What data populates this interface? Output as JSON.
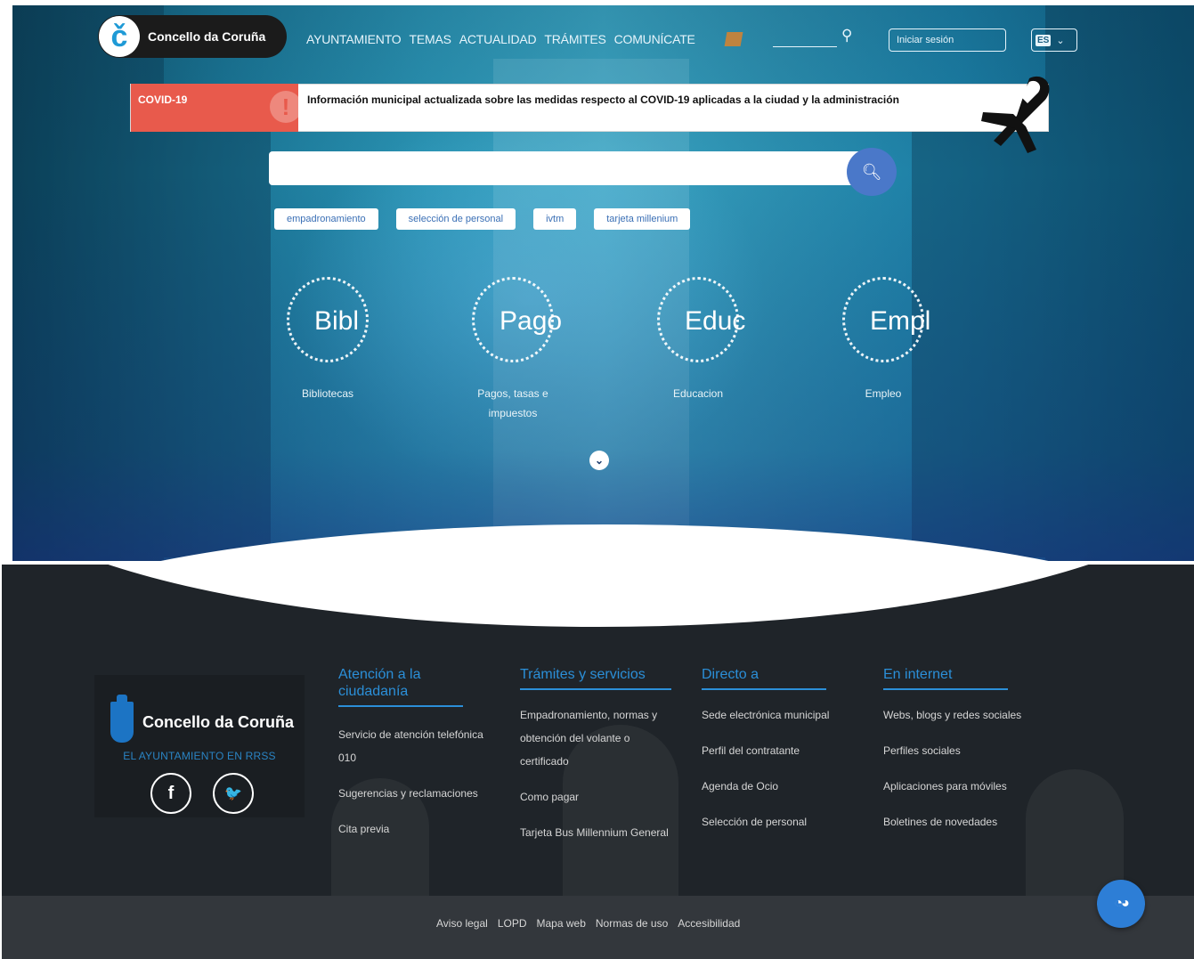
{
  "header": {
    "logo_glyph": "č",
    "logo_text": "Concello da Coruña",
    "nav": [
      "AYUNTAMIENTO",
      "TEMAS",
      "ACTUALIDAD",
      "TRÁMITES",
      "COMUNÍCATE"
    ],
    "login_label": "Iniciar sesión",
    "language": "ES",
    "search_icon": "search-icon",
    "accent_flag_color": "#d9832d"
  },
  "covid": {
    "tag": "COVID-19",
    "message": "Información municipal actualizada sobre las medidas respecto al COVID-19 aplicadas a la ciudad y la administración",
    "tag_color": "#e85a4c"
  },
  "search": {
    "placeholder": "",
    "button_icon": "search-icon",
    "button_color": "#4a78c9",
    "suggestions": [
      "empadronamiento",
      "selección de personal",
      "ivtm",
      "tarjeta millenium"
    ]
  },
  "quick_links": [
    {
      "word": "Bibl",
      "label": "Bibliotecas"
    },
    {
      "word": "Pago",
      "label": "Pagos, tasas e impuestos"
    },
    {
      "word": "Educ",
      "label": "Educacion"
    },
    {
      "word": "Empl",
      "label": "Empleo"
    }
  ],
  "footer": {
    "brand_name": "Concello da Coruña",
    "rrss_label": "EL AYUNTAMIENTO EN RRSS",
    "social": [
      {
        "icon": "facebook-icon",
        "glyph": "f"
      },
      {
        "icon": "twitter-icon",
        "glyph": "🐦"
      }
    ],
    "columns": [
      {
        "title": "Atención a la ciudadanía",
        "items": [
          "Servicio de atención telefónica 010",
          "Sugerencias y reclamaciones",
          "Cita previa"
        ]
      },
      {
        "title": "Trámites y servicios",
        "items": [
          "Empadronamiento, normas y obtención del volante o certificado",
          "Como pagar",
          "Tarjeta Bus Millennium General"
        ]
      },
      {
        "title": "Directo a",
        "items": [
          "Sede electrónica municipal",
          "Perfil del contratante",
          "Agenda de Ocio",
          "Selección de personal"
        ]
      },
      {
        "title": "En internet",
        "items": [
          "Webs, blogs y redes sociales",
          "Perfiles sociales",
          "Aplicaciones para móviles",
          "Boletines de novedades"
        ]
      }
    ],
    "legal": [
      "Aviso legal",
      "LOPD",
      "Mapa web",
      "Normas de uso",
      "Accesibilidad"
    ],
    "accent": "#2b8fd8"
  },
  "fab": {
    "icon": "chat-icon",
    "glyph": "◔◕"
  }
}
